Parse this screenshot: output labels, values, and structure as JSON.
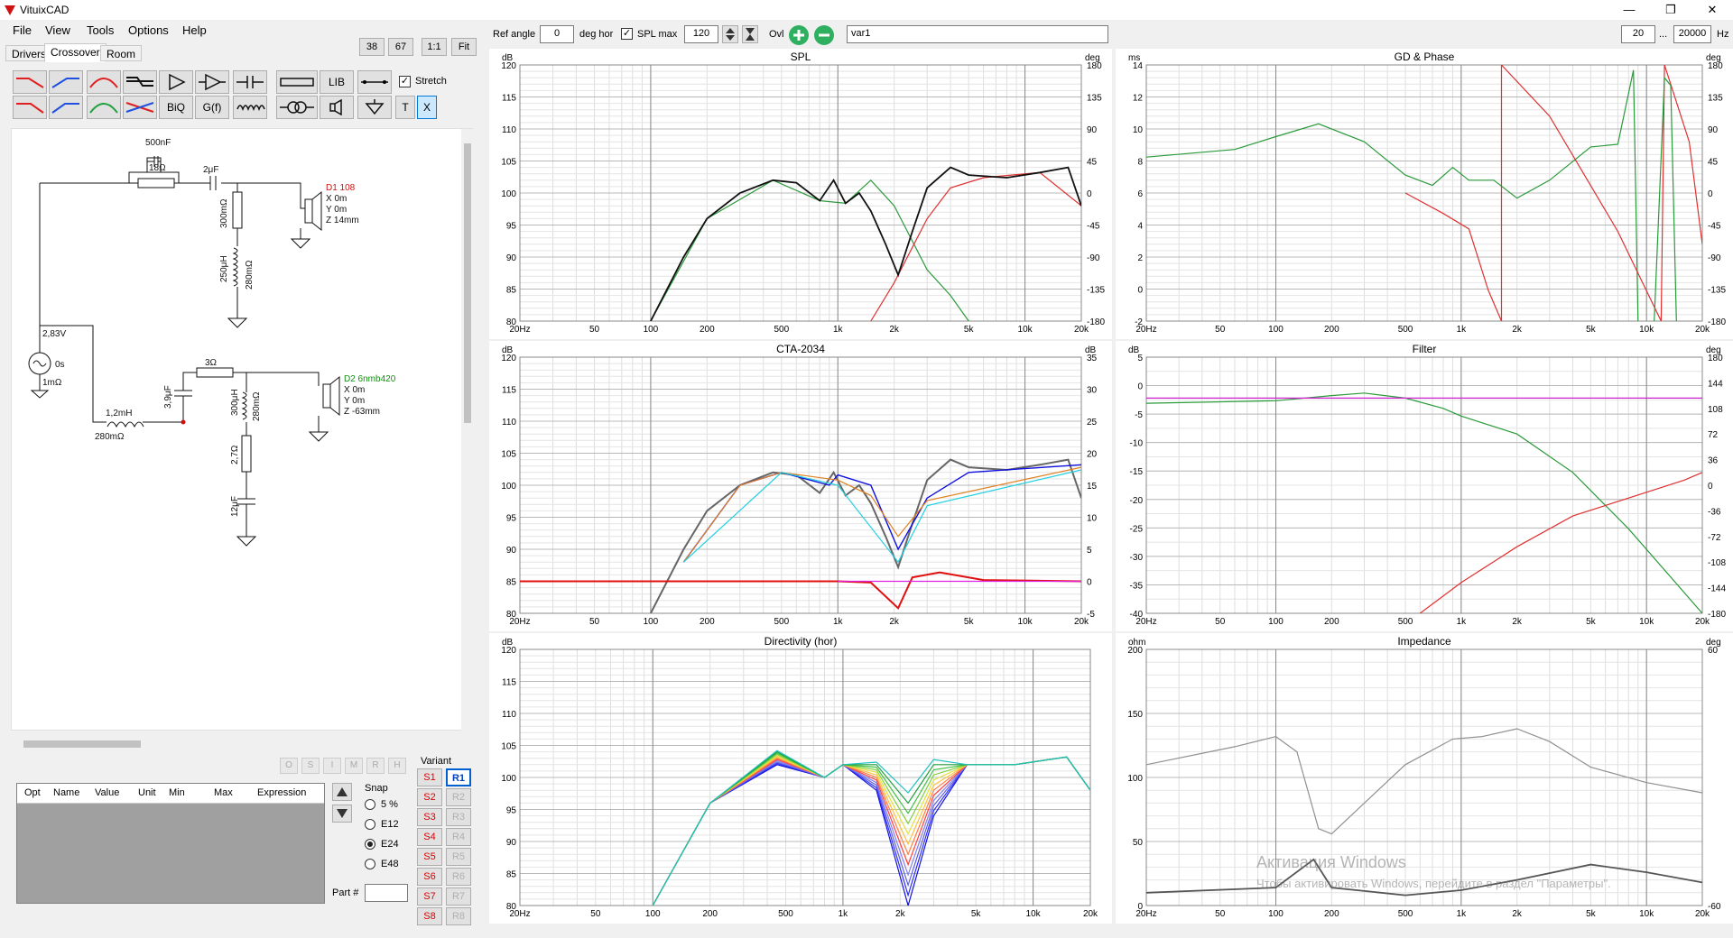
{
  "app": {
    "title": "VituixCAD"
  },
  "menu": [
    "File",
    "View",
    "Tools",
    "Options",
    "Help"
  ],
  "tabs": [
    "Drivers",
    "Crossover",
    "Room"
  ],
  "zoom_buttons": [
    "38",
    "67",
    "1:1",
    "Fit"
  ],
  "toolbar": {
    "lib": "LIB",
    "stretch": "Stretch",
    "biq": "BiQ",
    "gf": "G(f)",
    "t": "T",
    "x": "X"
  },
  "topbar": {
    "ref_angle_label": "Ref angle",
    "ref_angle": "0",
    "deg_hor": "deg hor",
    "spl_max_label": "SPL max",
    "spl_max": "120",
    "ovl": "Ovl",
    "variant_name": "var1",
    "freq_min": "20",
    "dots": "...",
    "freq_max": "20000",
    "hz": "Hz"
  },
  "schematic": {
    "c1": "500nF",
    "r1": "18Ω",
    "c2": "2μF",
    "r2": "300mΩ",
    "l1": "250μH",
    "l1r": "280mΩ",
    "d1": {
      "name": "D1 108",
      "x": "X 0m",
      "y": "Y 0m",
      "z": "Z 14mm"
    },
    "src_v": "2,83V",
    "src_t": "0s",
    "src_r": "1mΩ",
    "r3": "3Ω",
    "c3": "3,9μF",
    "l2": "1,2mH",
    "l2r": "280mΩ",
    "l3": "300μH",
    "l3r": "280mΩ",
    "r4": "2,7Ω",
    "c4": "12μF",
    "d2": {
      "name": "D2 6nmb420",
      "x": "X 0m",
      "y": "Y 0m",
      "z": "Z -63mm"
    }
  },
  "opt_buttons": [
    "O",
    "S",
    "I",
    "M",
    "R",
    "H"
  ],
  "parts_table": {
    "columns": [
      "Opt",
      "Name",
      "Value",
      "Unit",
      "Min",
      "Max",
      "Expression"
    ]
  },
  "snap": {
    "label": "Snap",
    "options": [
      "5 %",
      "E12",
      "E24",
      "E48"
    ],
    "selected": "E24"
  },
  "part_label": "Part #",
  "variant": {
    "label": "Variant",
    "s": [
      "S1",
      "S2",
      "S3",
      "S4",
      "S5",
      "S6",
      "S7",
      "S8"
    ],
    "r": [
      "R1",
      "R2",
      "R3",
      "R4",
      "R5",
      "R6",
      "R7",
      "R8"
    ],
    "selected": "R1"
  },
  "graphs": {
    "spl": {
      "title": "SPL",
      "left_unit": "dB",
      "right_unit": "deg",
      "y_left": [
        "120",
        "115",
        "110",
        "105",
        "100",
        "95",
        "90",
        "85",
        "80"
      ],
      "y_right": [
        "180",
        "135",
        "90",
        "45",
        "0",
        "-45",
        "-90",
        "-135",
        "-180"
      ]
    },
    "gd": {
      "title": "GD & Phase",
      "left_unit": "ms",
      "right_unit": "deg",
      "y_left": [
        "14",
        "12",
        "10",
        "8",
        "6",
        "4",
        "2",
        "0",
        "-2"
      ],
      "y_right": [
        "180",
        "135",
        "90",
        "45",
        "0",
        "-45",
        "-90",
        "-135",
        "-180"
      ]
    },
    "cta": {
      "title": "CTA-2034",
      "left_unit": "dB",
      "right_unit": "dB",
      "y_left": [
        "120",
        "115",
        "110",
        "105",
        "100",
        "95",
        "90",
        "85",
        "80"
      ],
      "y_right": [
        "35",
        "30",
        "25",
        "20",
        "15",
        "10",
        "5",
        "0",
        "-5"
      ]
    },
    "filter": {
      "title": "Filter",
      "left_unit": "dB",
      "right_unit": "deg",
      "y_left": [
        "5",
        "0",
        "-5",
        "-10",
        "-15",
        "-20",
        "-25",
        "-30",
        "-35",
        "-40"
      ],
      "y_right": [
        "180",
        "144",
        "108",
        "72",
        "36",
        "0",
        "-36",
        "-72",
        "-108",
        "-144",
        "-180"
      ]
    },
    "dir": {
      "title": "Directivity (hor)",
      "left_unit": "dB",
      "right_unit": "",
      "y_left": [
        "120",
        "115",
        "110",
        "105",
        "100",
        "95",
        "90",
        "85",
        "80"
      ],
      "y_right": []
    },
    "imp": {
      "title": "Impedance",
      "left_unit": "ohm",
      "right_unit": "deg",
      "y_left": [
        "200",
        "150",
        "100",
        "50",
        "0"
      ],
      "y_right": [
        "60",
        "",
        "",
        "-60"
      ]
    },
    "x_ticks": [
      "20Hz",
      "50",
      "100",
      "200",
      "500",
      "1k",
      "2k",
      "5k",
      "10k",
      "20k"
    ]
  },
  "watermark": {
    "line1": "Активация Windows",
    "line2": "Чтобы активировать Windows, перейдите в раздел \"Параметры\"."
  }
}
